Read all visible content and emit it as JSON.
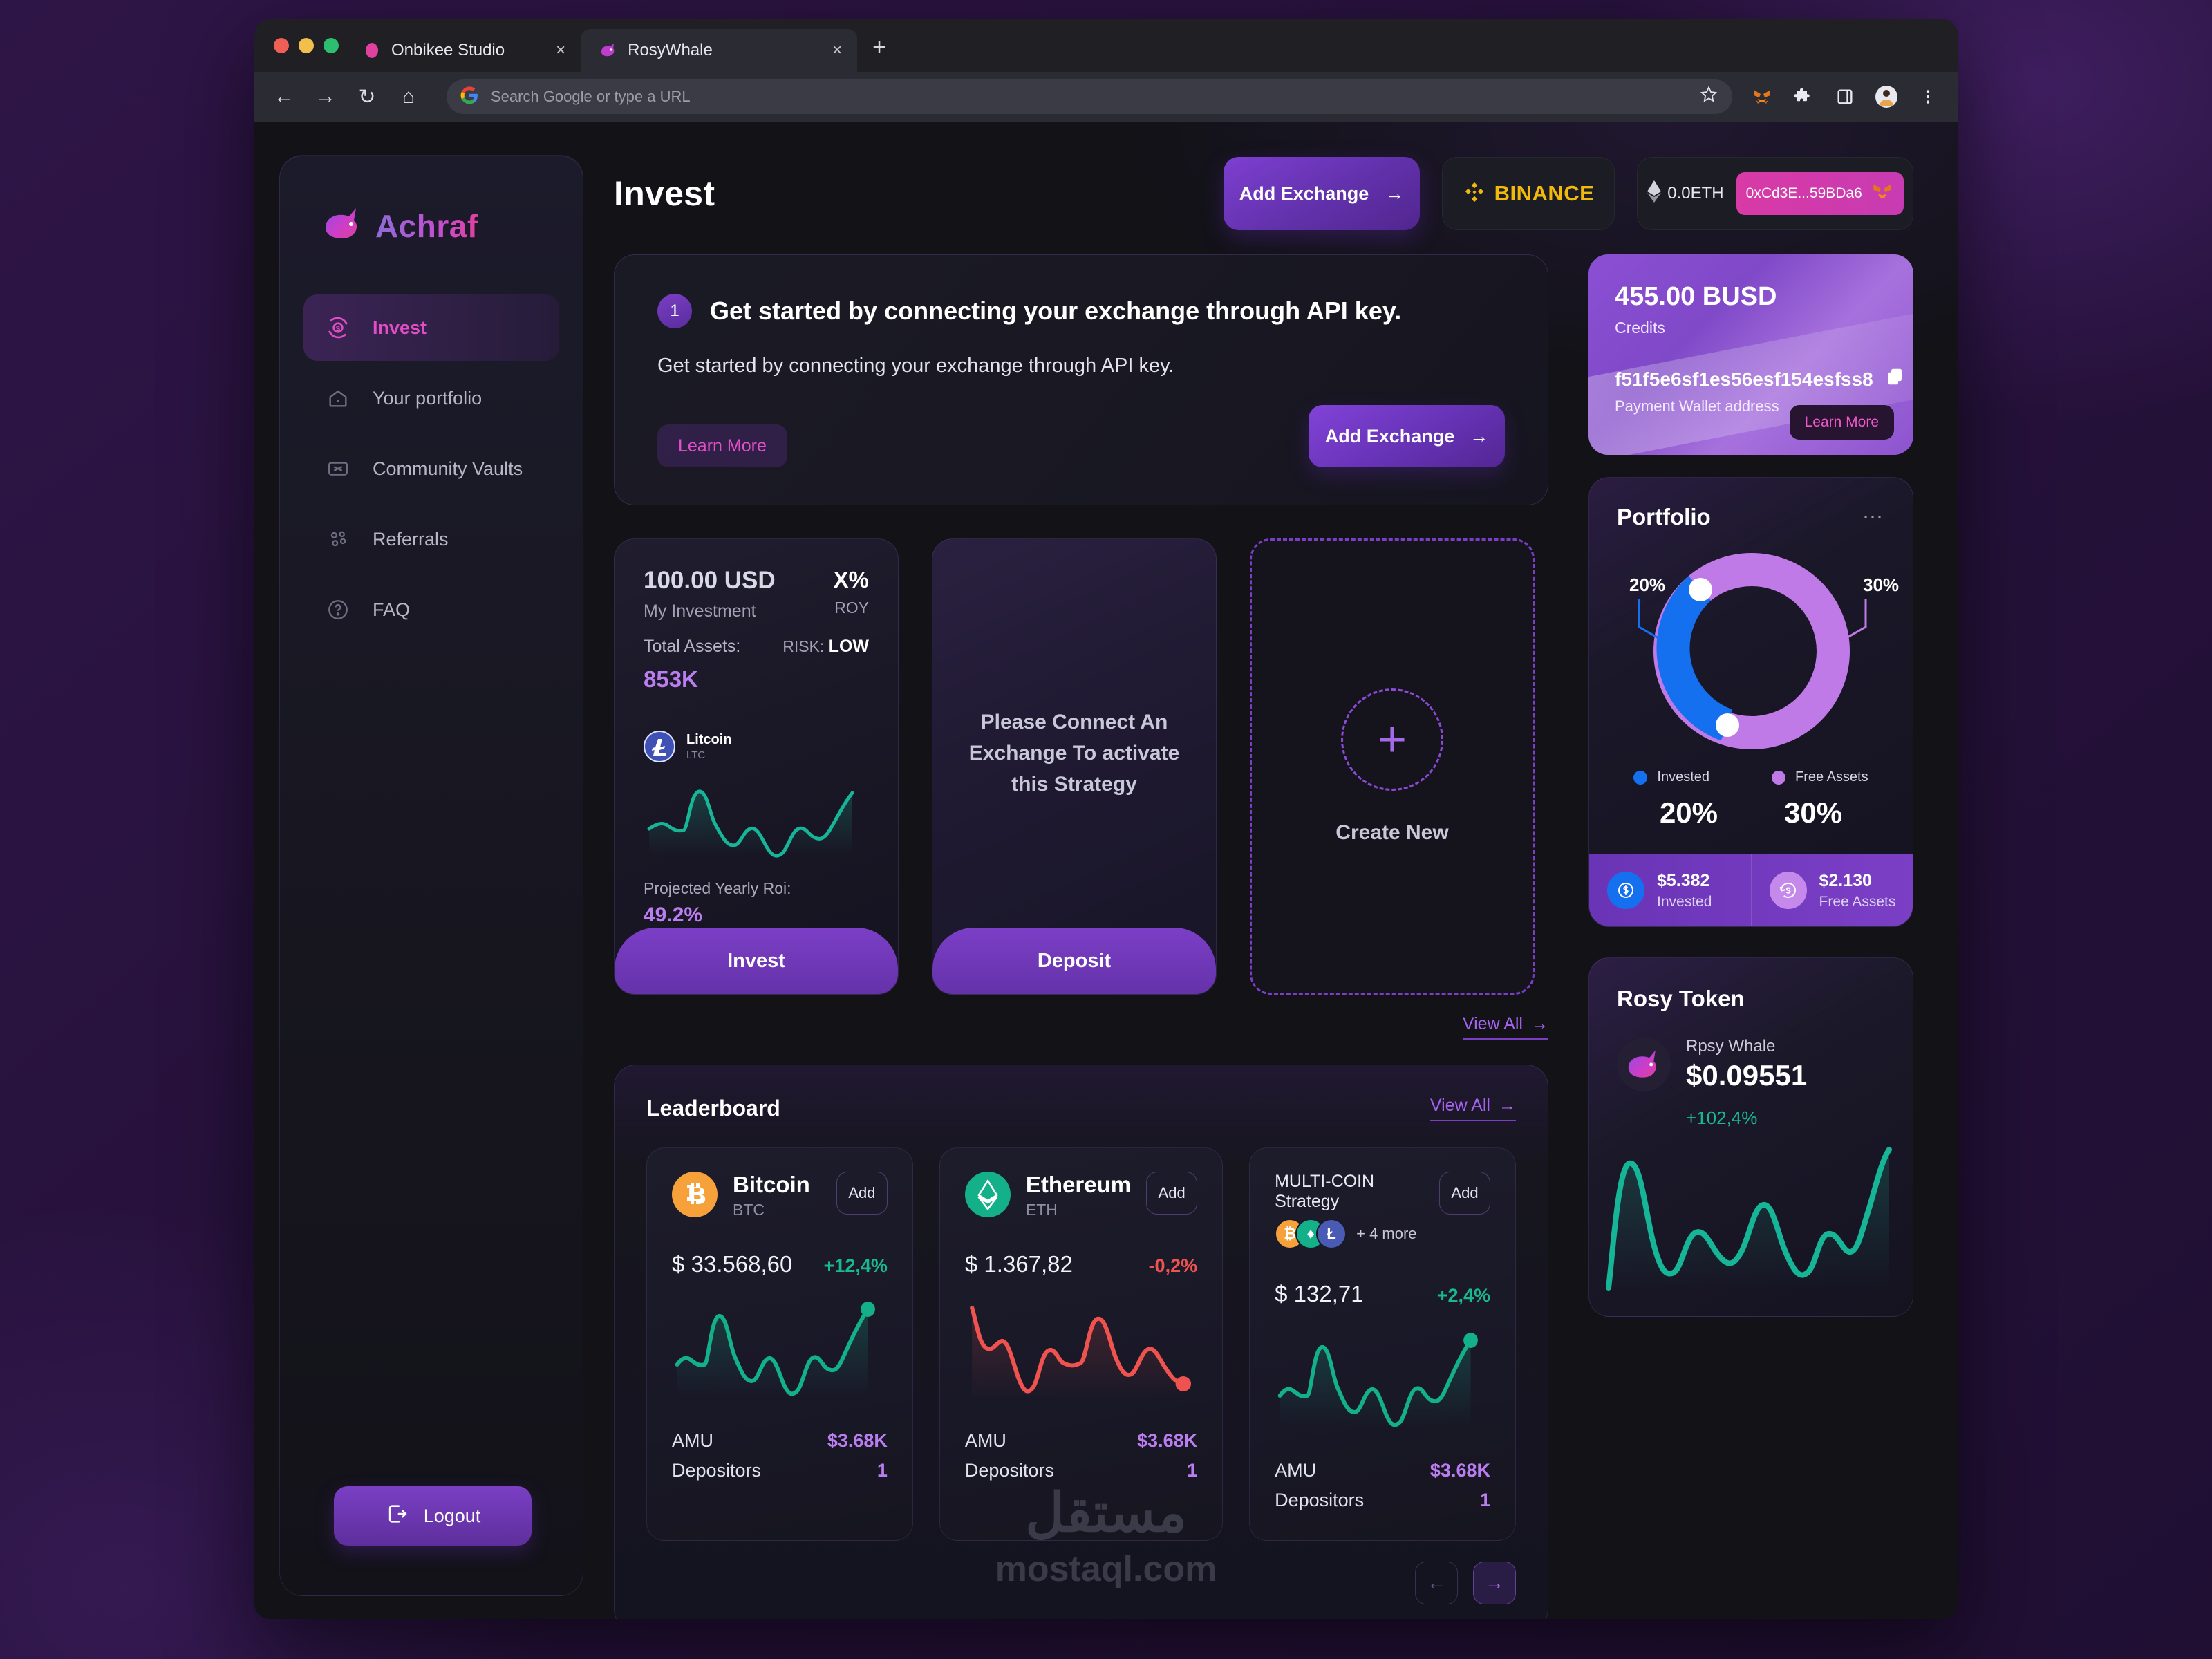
{
  "browser": {
    "tabs": [
      {
        "title": "Onbikee Studio",
        "favicon": "rosy-dot-icon",
        "active": false
      },
      {
        "title": "RosyWhale",
        "favicon": "whale-icon",
        "active": true
      }
    ],
    "new_tab_label": "+",
    "close_label": "×",
    "nav": {
      "back": "←",
      "forward": "→",
      "reload": "↻",
      "home": "⌂"
    },
    "omnibox_placeholder": "Search Google or type a URL",
    "omnibox_value": "",
    "icons": [
      "bookmark-star-icon",
      "metamask-icon",
      "extensions-puzzle-icon",
      "sidepanel-icon",
      "profile-avatar-icon",
      "kebab-menu-icon"
    ]
  },
  "sidebar": {
    "brand": "Achraf",
    "items": [
      {
        "label": "Invest",
        "icon": "invest-cycle-icon",
        "active": true
      },
      {
        "label": "Your portfolio",
        "icon": "home-icon",
        "active": false
      },
      {
        "label": "Community Vaults",
        "icon": "vault-icon",
        "active": false
      },
      {
        "label": "Referrals",
        "icon": "people-icon",
        "active": false
      },
      {
        "label": "FAQ",
        "icon": "question-icon",
        "active": false
      }
    ],
    "logout_label": "Logout"
  },
  "header": {
    "page_title": "Invest",
    "add_exchange_label": "Add Exchange",
    "add_exchange_arrow": "→",
    "binance_label": "BINANCE",
    "eth_balance": "0.0ETH",
    "wallet_address": "0xCd3E...59BDa6"
  },
  "banner": {
    "step": "1",
    "title": "Get started by connecting your exchange through API key.",
    "subtitle": "Get started by connecting your exchange through API key.",
    "learn_more_label": "Learn More",
    "add_exchange_label": "Add Exchange",
    "arrow": "→"
  },
  "busd_card": {
    "amount": "455.00 BUSD",
    "credits_label": "Credits",
    "wallet_hash": "f51f5e6sf1es56esf154esfss8",
    "wallet_label": "Payment Wallet address",
    "copy_icon": "copy-icon",
    "learn_more_label": "Learn More"
  },
  "strategy_card": {
    "amount": "100.00 USD",
    "amount_label": "My Investment",
    "roy_value": "X%",
    "roy_label": "ROY",
    "total_assets_label": "Total Assets:",
    "total_assets_value": "853K",
    "risk_label": "RISK:",
    "risk_value": "LOW",
    "coin_name": "Litcoin",
    "coin_symbol": "LTC",
    "roi_label": "Projected Yearly Roi:",
    "roi_value": "49.2%",
    "cta_label": "Invest"
  },
  "locked_card": {
    "message": "Please Connect An Exchange To activate this Strategy",
    "cta_label": "Deposit"
  },
  "create_card": {
    "plus_icon": "plus-icon",
    "label": "Create New"
  },
  "strategies_view_all": "View All",
  "portfolio": {
    "title": "Portfolio",
    "menu_icon": "kebab-dots-icon",
    "legend": [
      {
        "label": "Invested",
        "color": "#1570ef",
        "value": "20%"
      },
      {
        "label": "Free Assets",
        "color": "#c07ae8",
        "value": "30%"
      }
    ],
    "footer": [
      {
        "amount": "$5.382",
        "label": "Invested",
        "icon": "dollar-circle-icon",
        "color": "#1570ef"
      },
      {
        "amount": "$2.130",
        "label": "Free Assets",
        "icon": "refund-circle-icon",
        "color": "#c589ec"
      }
    ]
  },
  "leaderboard": {
    "title": "Leaderboard",
    "view_all": "View All",
    "add_label": "Add",
    "amu_label": "AMU",
    "depositors_label": "Depositors",
    "cards": [
      {
        "name": "Bitcoin",
        "symbol": "BTC",
        "icon": "bitcoin-icon",
        "icon_color": "#f7a13a",
        "price": "$ 33.568,60",
        "change": "+12,4%",
        "direction": "up",
        "amu": "$3.68K",
        "depositors": "1"
      },
      {
        "name": "Ethereum",
        "symbol": "ETH",
        "icon": "ethereum-icon",
        "icon_color": "#14b08a",
        "price": "$ 1.367,82",
        "change": "-0,2%",
        "direction": "down",
        "amu": "$3.68K",
        "depositors": "1"
      },
      {
        "name": "MULTI-COIN Strategy",
        "symbol": "+ 4 more",
        "icon": "multi-coin-icon",
        "icon_color": "#7b3fc6",
        "price": "$ 132,71",
        "change": "+2,4%",
        "direction": "up",
        "amu": "$3.68K",
        "depositors": "1"
      }
    ],
    "pager": {
      "prev": "←",
      "next": "→"
    }
  },
  "rosy_token": {
    "title": "Rosy Token",
    "name": "Rpsy Whale",
    "price": "$0.09551",
    "change": "+102,4%",
    "avatar": "whale-avatar-icon"
  },
  "watermark": {
    "arabic": "مستقل",
    "latin": "mostaql.com"
  },
  "chart_data": [
    {
      "type": "pie",
      "title": "Portfolio",
      "labels": [
        "Invested",
        "Free Assets"
      ],
      "values": [
        20,
        30
      ],
      "colors": [
        "#1570ef",
        "#c07ae8"
      ],
      "annotations": [
        "20%",
        "30%"
      ],
      "legend": "bottom"
    },
    {
      "type": "area",
      "title": "Litcoin (LTC) strategy sparkline",
      "color": "#17b597",
      "y": [
        30,
        36,
        30,
        30,
        72,
        52,
        38,
        22,
        38,
        30,
        10,
        34,
        52,
        44,
        34,
        56,
        86
      ],
      "ylim": [
        0,
        100
      ],
      "grid": false
    },
    {
      "type": "area",
      "title": "Bitcoin sparkline",
      "color": "#14b08a",
      "y": [
        32,
        40,
        32,
        32,
        74,
        54,
        40,
        22,
        40,
        32,
        12,
        36,
        54,
        44,
        36,
        58,
        92
      ],
      "ylim": [
        0,
        100
      ],
      "grid": false
    },
    {
      "type": "area",
      "title": "Ethereum sparkline",
      "color": "#ef5350",
      "y": [
        86,
        52,
        58,
        20,
        8,
        44,
        52,
        32,
        32,
        74,
        66,
        26,
        34,
        52,
        36,
        20,
        14
      ],
      "ylim": [
        0,
        100
      ],
      "grid": false
    },
    {
      "type": "area",
      "title": "Multi-coin sparkline",
      "color": "#14b08a",
      "y": [
        30,
        38,
        30,
        32,
        70,
        50,
        38,
        20,
        38,
        30,
        12,
        34,
        52,
        42,
        34,
        56,
        90
      ],
      "ylim": [
        0,
        100
      ],
      "grid": false
    },
    {
      "type": "area",
      "title": "Rosy Token sparkline",
      "color": "#17b597",
      "y": [
        6,
        68,
        72,
        24,
        16,
        44,
        40,
        30,
        24,
        66,
        30,
        14,
        46,
        36,
        60,
        40,
        94
      ],
      "ylim": [
        0,
        100
      ],
      "grid": false
    }
  ]
}
